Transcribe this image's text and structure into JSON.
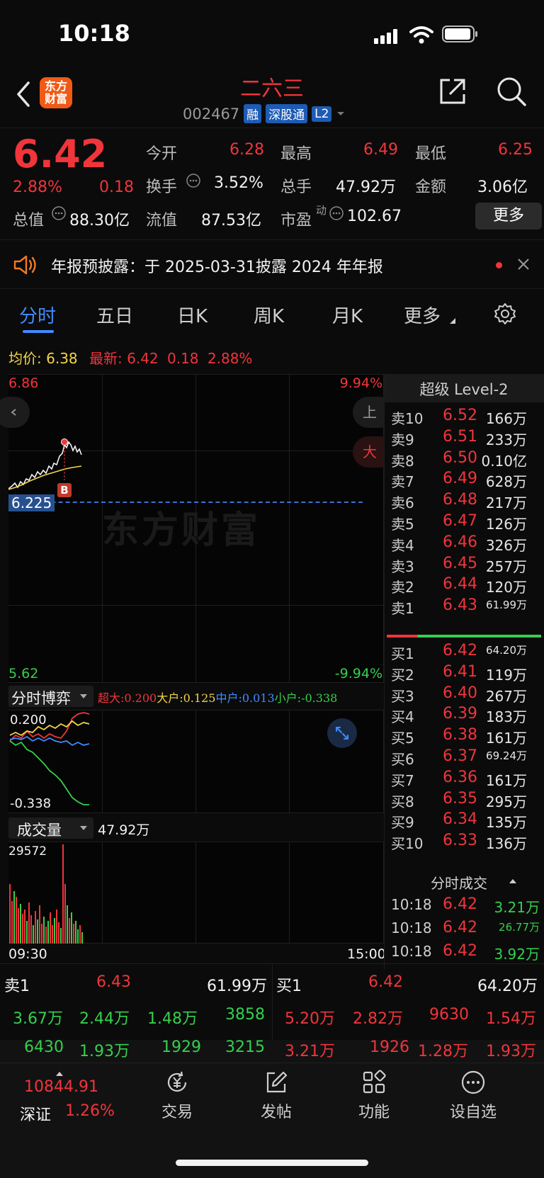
{
  "status_bar": {
    "time": "10:18"
  },
  "header": {
    "logo_text": "东方财富",
    "stock_name": "二六三",
    "stock_code": "002467",
    "tags": [
      "融",
      "深股通",
      "L2"
    ]
  },
  "quote": {
    "price": "6.42",
    "change_pct": "2.88%",
    "change": "0.18",
    "open_label": "今开",
    "open": "6.28",
    "high_label": "最高",
    "high": "6.49",
    "low_label": "最低",
    "low": "6.25",
    "turnover_label": "换手",
    "turnover": "3.52%",
    "volume_label": "总手",
    "volume": "47.92万",
    "amount_label": "金额",
    "amount": "3.06亿",
    "mktcap_label": "总值",
    "mktcap": "88.30亿",
    "float_label": "流值",
    "float": "87.53亿",
    "pe_label": "市盈",
    "pe_sup": "动",
    "pe": "102.67",
    "more_button": "更多"
  },
  "notice": {
    "text": "年报预披露：于 2025-03-31披露 2024 年年报"
  },
  "tabs": [
    "分时",
    "五日",
    "日K",
    "周K",
    "月K",
    "更多"
  ],
  "intraday": {
    "avg_label": "均价:",
    "avg": "6.38",
    "latest_label": "最新:",
    "latest": "6.42",
    "latest_change": "0.18",
    "latest_pct": "2.88%",
    "top_price": "6.86",
    "top_pct": "9.94%",
    "bottom_price": "5.62",
    "bottom_pct": "-9.94%",
    "ref_price": "6.225",
    "marker": "B",
    "side_btn_1": "上",
    "side_btn_2": "大",
    "watermark": "东方财富"
  },
  "game_panel": {
    "title": "分时博弈",
    "super_label": "超大:",
    "super_val": "0.200",
    "large_label": "大户:",
    "large_val": "0.125",
    "mid_label": "中户:",
    "mid_val": "0.013",
    "small_label": "小户:",
    "small_val": "-0.338",
    "axis_top": "0.200",
    "axis_bottom": "-0.338",
    "colors": {
      "super": "#f0353b",
      "large": "#f3d64a",
      "mid": "#3f8cff",
      "small": "#35d04d"
    }
  },
  "volume_panel": {
    "title": "成交量",
    "total": "47.92万",
    "axis_top": "29572",
    "time_start": "09:30",
    "time_end": "15:00"
  },
  "orderbook": {
    "title": "超级 Level-2",
    "asks": [
      {
        "label": "卖10",
        "price": "6.52",
        "vol": "166万",
        "dot": "#3f8cff"
      },
      {
        "label": "卖9",
        "price": "6.51",
        "vol": "233万",
        "dot": "#3f8cff"
      },
      {
        "label": "卖8",
        "price": "6.50",
        "vol": "0.10亿",
        "dot": "#3f8cff"
      },
      {
        "label": "卖7",
        "price": "6.49",
        "vol": "628万",
        "dot": "#3f8cff"
      },
      {
        "label": "卖6",
        "price": "6.48",
        "vol": "217万",
        "dot": "#3f8cff"
      },
      {
        "label": "卖5",
        "price": "6.47",
        "vol": "126万",
        "dot": "#3a3a3a"
      },
      {
        "label": "卖4",
        "price": "6.46",
        "vol": "326万",
        "dot": "#3f8cff"
      },
      {
        "label": "卖3",
        "price": "6.45",
        "vol": "257万",
        "dot": "#3f8cff"
      },
      {
        "label": "卖2",
        "price": "6.44",
        "vol": "120万",
        "dot": "#3f8cff"
      },
      {
        "label": "卖1",
        "price": "6.43",
        "vol": "61.99万",
        "dot": "#3a3a3a"
      }
    ],
    "bids": [
      {
        "label": "买1",
        "price": "6.42",
        "vol": "64.20万",
        "dot": "#3a3a3a"
      },
      {
        "label": "买2",
        "price": "6.41",
        "vol": "119万",
        "dot": "#f07a22"
      },
      {
        "label": "买3",
        "price": "6.40",
        "vol": "267万",
        "dot": "#f07a22"
      },
      {
        "label": "买4",
        "price": "6.39",
        "vol": "183万",
        "dot": "#f07a22"
      },
      {
        "label": "买5",
        "price": "6.38",
        "vol": "161万",
        "dot": "#f07a22"
      },
      {
        "label": "买6",
        "price": "6.37",
        "vol": "69.24万",
        "dot": "#f07a22"
      },
      {
        "label": "买7",
        "price": "6.36",
        "vol": "161万",
        "dot": "#f07a22"
      },
      {
        "label": "买8",
        "price": "6.35",
        "vol": "295万",
        "dot": "#f07a22"
      },
      {
        "label": "买9",
        "price": "6.34",
        "vol": "135万",
        "dot": "#f07a22"
      },
      {
        "label": "买10",
        "price": "6.33",
        "vol": "136万",
        "dot": "#f07a22"
      }
    ],
    "trades_title": "分时成交",
    "trades": [
      {
        "time": "10:18",
        "price": "6.42",
        "vol": "3.21万"
      },
      {
        "time": "10:18",
        "price": "6.42",
        "vol": "26.77万"
      },
      {
        "time": "10:18",
        "price": "6.42",
        "vol": "3.92万"
      }
    ]
  },
  "bottom_stats": {
    "sell_label": "卖1",
    "sell_price": "6.43",
    "sell_vol": "61.99万",
    "buy_label": "买1",
    "buy_price": "6.42",
    "buy_vol": "64.20万",
    "sell_queue_1": [
      "3.67万",
      "2.44万",
      "1.48万",
      "3858"
    ],
    "sell_queue_2": [
      "6430",
      "1.93万",
      "1929",
      "3215"
    ],
    "buy_queue_1": [
      "5.20万",
      "2.82万",
      "9630",
      "1.54万"
    ],
    "buy_queue_2": [
      "3.21万",
      "1926",
      "1.28万",
      "1.93万"
    ]
  },
  "tabbar": {
    "index_value": "10844.91",
    "index_name": "深证",
    "index_pct": "1.26%",
    "items": [
      "交易",
      "发帖",
      "功能",
      "设自选"
    ]
  }
}
